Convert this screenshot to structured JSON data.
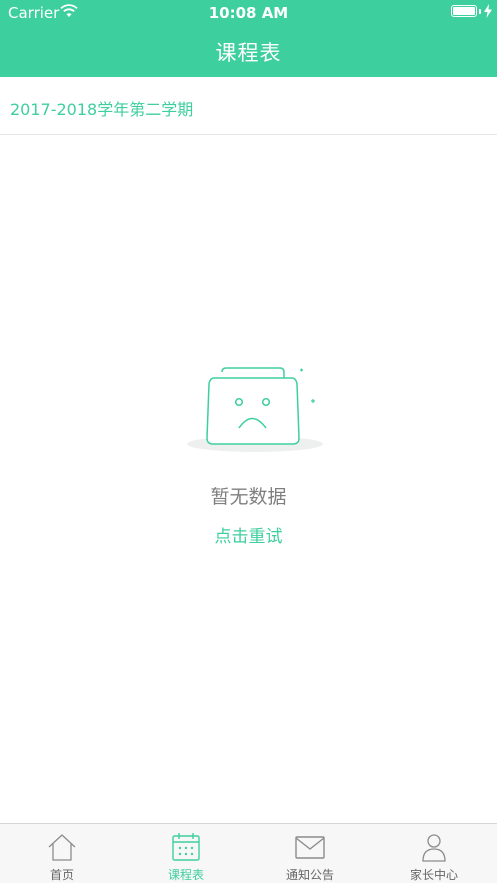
{
  "status_bar": {
    "carrier": "Carrier",
    "time": "10:08 AM"
  },
  "header": {
    "title": "课程表"
  },
  "semester": {
    "label": "2017-2018学年第二学期"
  },
  "empty_state": {
    "message": "暂无数据",
    "retry": "点击重试"
  },
  "tabs": [
    {
      "label": "首页",
      "icon": "home-icon",
      "active": false
    },
    {
      "label": "课程表",
      "icon": "calendar-icon",
      "active": true
    },
    {
      "label": "通知公告",
      "icon": "envelope-icon",
      "active": false
    },
    {
      "label": "家长中心",
      "icon": "person-icon",
      "active": false
    }
  ],
  "colors": {
    "accent": "#3ecf9e",
    "text_gray": "#7f7f7f",
    "tab_gray": "#666666"
  }
}
